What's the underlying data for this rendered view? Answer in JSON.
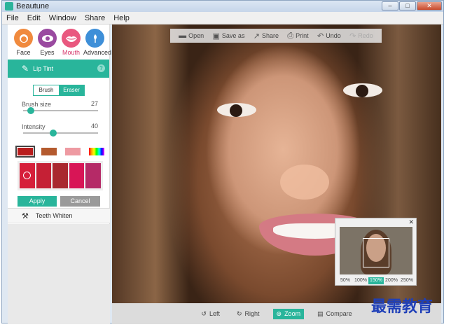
{
  "window": {
    "title": "Beautune",
    "controls": [
      "–",
      "□",
      "✕"
    ]
  },
  "menu": [
    "File",
    "Edit",
    "Window",
    "Share",
    "Help"
  ],
  "tabs": [
    {
      "label": "Face",
      "icon": "face-icon",
      "color": "#f08a3e",
      "active": false
    },
    {
      "label": "Eyes",
      "icon": "eye-icon",
      "color": "#9a4aa0",
      "active": false
    },
    {
      "label": "Mouth",
      "icon": "lips-icon",
      "color": "#e9587f",
      "active": true
    },
    {
      "label": "Advanced",
      "icon": "gear-icon",
      "color": "#3e8fd8",
      "active": false
    }
  ],
  "lip_tint": {
    "title": "Lip Tint",
    "help": "?",
    "modes": [
      "Brush",
      "Eraser"
    ],
    "brush_size": {
      "label": "Brush size",
      "value": "27",
      "fraction": 0.1
    },
    "intensity": {
      "label": "Intensity",
      "value": "40",
      "fraction": 0.4
    },
    "swatches": [
      "#b91c1c",
      "#b45a2e",
      "#ee9aa2",
      "rainbow"
    ],
    "palette": [
      "#d61f3a",
      "#c52035",
      "#a9282f",
      "#d81556",
      "#b52a67"
    ],
    "apply": "Apply",
    "cancel": "Cancel"
  },
  "teeth_whiten": {
    "label": "Teeth Whiten"
  },
  "toolbar": {
    "open": "Open",
    "save_as": "Save as",
    "share": "Share",
    "print": "Print",
    "undo": "Undo",
    "redo": "Redo"
  },
  "navigator": {
    "close": "✕",
    "zooms": [
      "50%",
      "100%",
      "150%",
      "200%",
      "250%"
    ],
    "active_zoom": "150%"
  },
  "bottom_bar": {
    "left": "Left",
    "right": "Right",
    "zoom": "Zoom",
    "compare": "Compare"
  },
  "watermark": "最需教育",
  "colors": {
    "accent": "#29b59b",
    "mouth_active": "#d6386b"
  }
}
